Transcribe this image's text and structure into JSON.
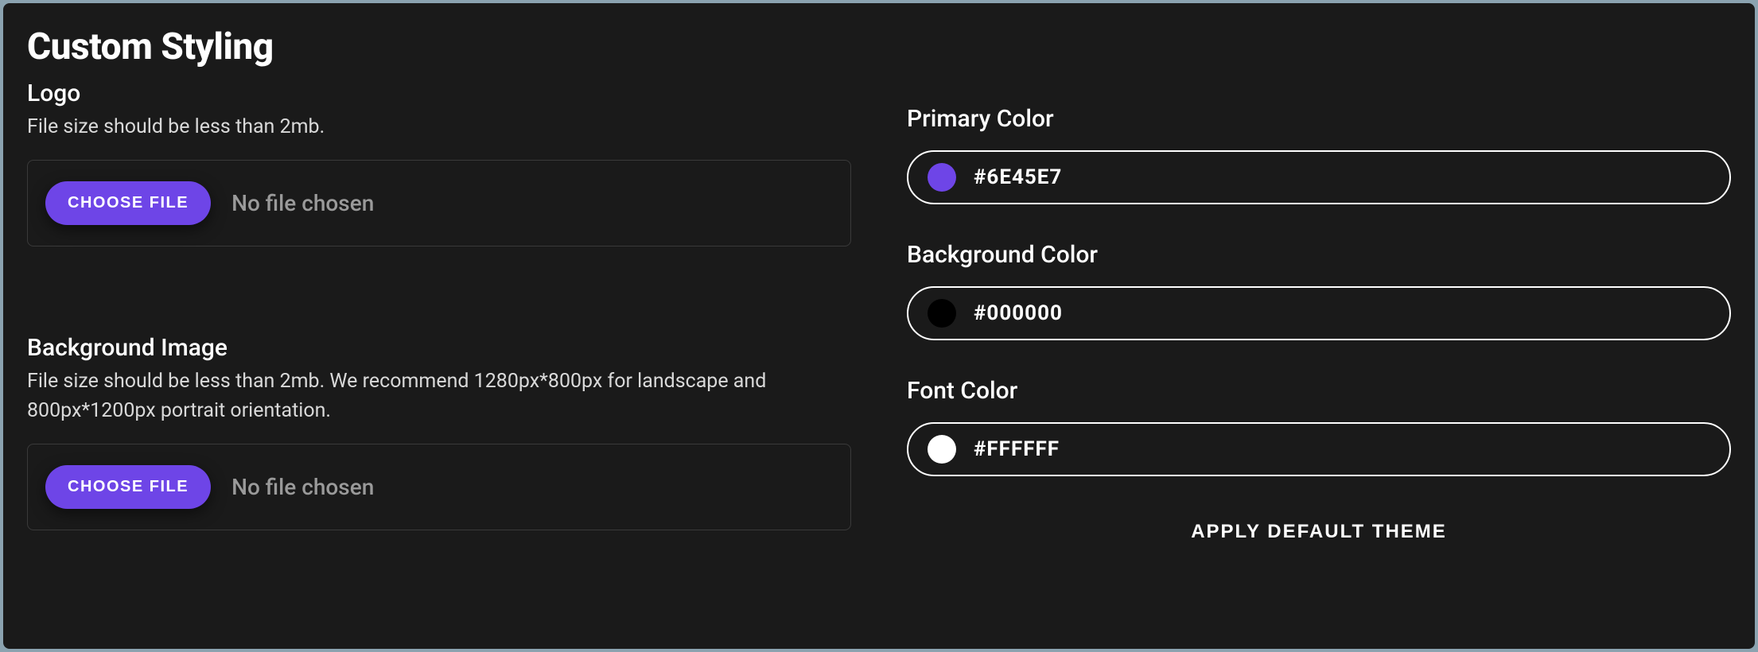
{
  "title": "Custom Styling",
  "left": {
    "logo": {
      "label": "Logo",
      "hint": "File size should be less than 2mb.",
      "choose_label": "CHOOSE FILE",
      "status": "No file chosen"
    },
    "background_image": {
      "label": "Background Image",
      "hint": "File size should be less than 2mb. We recommend 1280px*800px for landscape and 800px*1200px portrait orientation.",
      "choose_label": "CHOOSE FILE",
      "status": "No file chosen"
    }
  },
  "right": {
    "primary_color": {
      "label": "Primary Color",
      "value": "#6E45E7",
      "swatch": "#6e45e7"
    },
    "background_color": {
      "label": "Background Color",
      "value": "#000000",
      "swatch": "#000000"
    },
    "font_color": {
      "label": "Font Color",
      "value": "#FFFFFF",
      "swatch": "#ffffff"
    },
    "apply_label": "APPLY DEFAULT THEME"
  }
}
